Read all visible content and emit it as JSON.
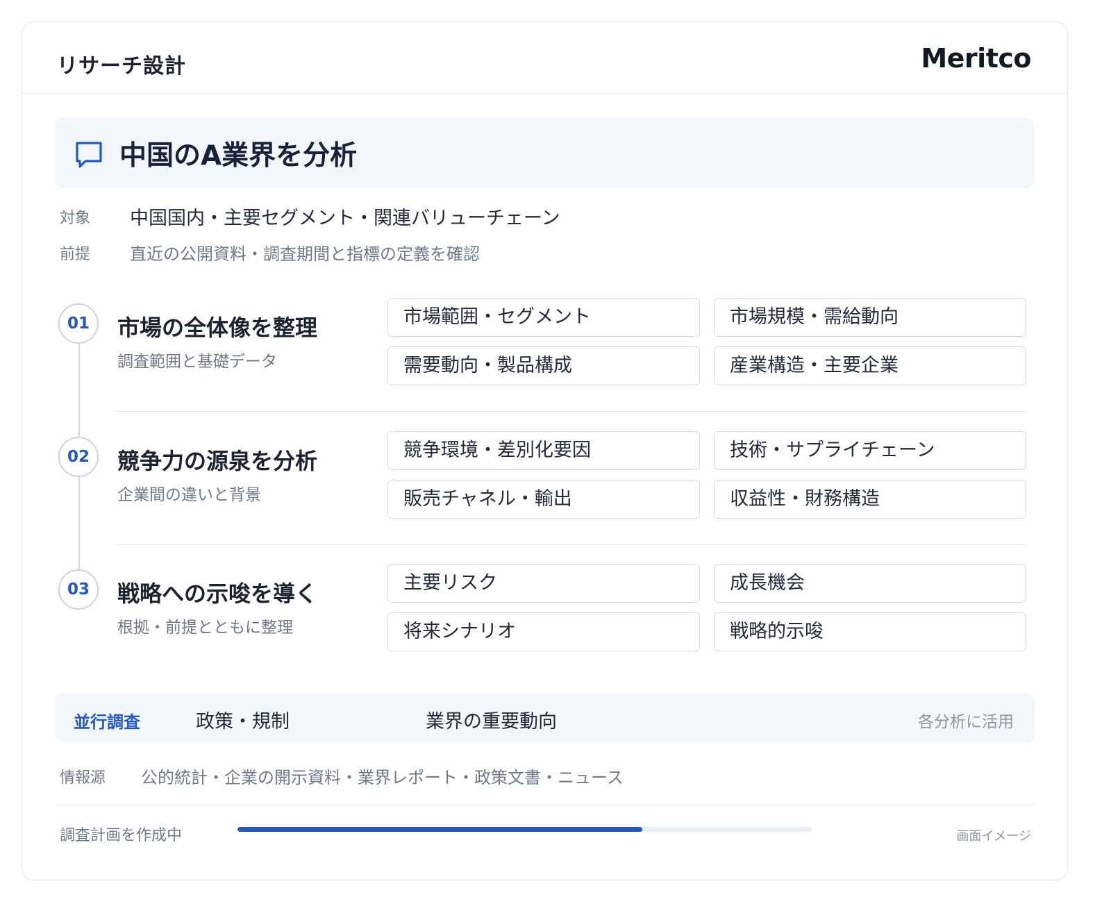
{
  "header": {
    "title": "リサーチ設計",
    "brand": "Meritco"
  },
  "query": {
    "icon": "chat-bubble-icon",
    "text": "中国のA業界を分析"
  },
  "meta": {
    "target": {
      "label": "対象",
      "value": "中国国内・主要セグメント・関連バリューチェーン"
    },
    "premise": {
      "label": "前提",
      "value": "直近の公開資料・調査期間と指標の定義を確認"
    }
  },
  "steps": [
    {
      "number": "01",
      "title": "市場の全体像を整理",
      "subtitle": "調査範囲と基礎データ",
      "items": [
        "市場範囲・セグメント",
        "市場規模・需給動向",
        "需要動向・製品構成",
        "産業構造・主要企業"
      ]
    },
    {
      "number": "02",
      "title": "競争力の源泉を分析",
      "subtitle": "企業間の違いと背景",
      "items": [
        "競争環境・差別化要因",
        "技術・サプライチェーン",
        "販売チャネル・輸出",
        "収益性・財務構造"
      ]
    },
    {
      "number": "03",
      "title": "戦略への示唆を導く",
      "subtitle": "根拠・前提とともに整理",
      "items": [
        "主要リスク",
        "成長機会",
        "将来シナリオ",
        "戦略的示唆"
      ]
    }
  ],
  "parallel": {
    "label": "並行調査",
    "items": [
      "政策・規制",
      "業界の重要動向"
    ],
    "note": "各分析に活用"
  },
  "sources": {
    "label": "情報源",
    "value": "公的統計・企業の開示資料・業界レポート・政策文書・ニュース"
  },
  "footer": {
    "status": "調査計画を作成中",
    "progress": 0.705,
    "image_note": "画面イメージ"
  },
  "colors": {
    "accent": "#2157c7",
    "panel_bg": "#f3f7fc",
    "muted_text": "#6e7a8c"
  }
}
